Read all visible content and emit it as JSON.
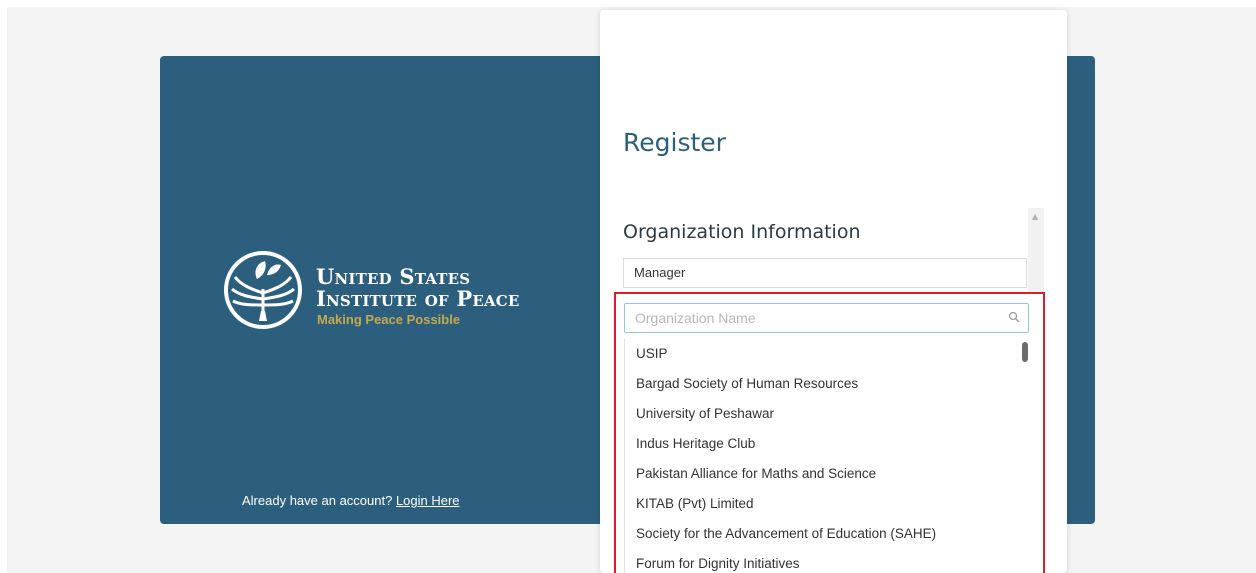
{
  "branding": {
    "line1": "United States",
    "line2": "Institute of Peace",
    "tagline": "Making Peace Possible",
    "emblem_icon": "dove-olive-branch-icon",
    "tagline_color": "#c7a94c"
  },
  "login": {
    "prompt": "Already have an account? ",
    "link_label": "Login Here"
  },
  "form": {
    "title": "Register",
    "section_title": "Organization Information",
    "role_value": "Manager",
    "organization_search": {
      "placeholder": "Organization Name",
      "icon": "search-icon"
    },
    "organization_options": [
      "USIP",
      "Bargad Society of Human Resources",
      "University of Peshawar",
      "Indus Heritage Club",
      "Pakistan Alliance for Maths and Science",
      "KITAB (Pvt) Limited",
      "Society for the Advancement of Education (SAHE)",
      "Forum for Dignity Initiatives"
    ]
  },
  "colors": {
    "panel_blue": "#2c5f7e",
    "highlight_red": "#d9202a",
    "focus_blue": "#8fc6ea"
  }
}
